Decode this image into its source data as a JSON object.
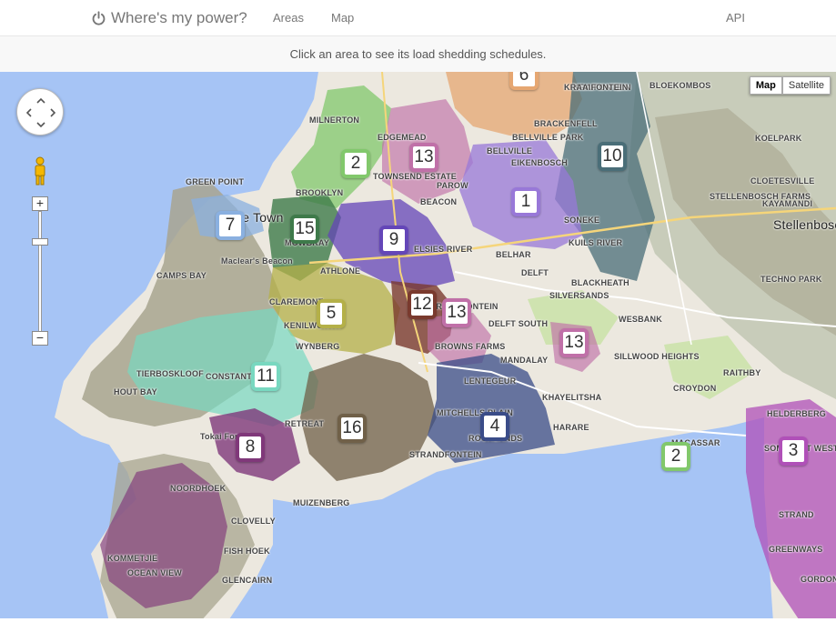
{
  "app": {
    "title": "Where's my power?",
    "nav": [
      "Areas",
      "Map",
      "API"
    ]
  },
  "instruction": "Click an area to see its load shedding schedules.",
  "map": {
    "type_controls": [
      "Map",
      "Satellite"
    ],
    "active_type": "Map",
    "zoom_in": "+",
    "zoom_out": "−",
    "colors": {
      "ocean": "#a6c4f5",
      "land": "#ece8df",
      "mountain": "#a8a58f",
      "green": "#cfe3b0"
    },
    "markers": [
      {
        "label": "6",
        "color": "#e6a772"
      },
      {
        "label": "2",
        "color": "#82c86c"
      },
      {
        "label": "13",
        "color": "#c070a8"
      },
      {
        "label": "10",
        "color": "#4a6e78"
      },
      {
        "label": "1",
        "color": "#9878d8"
      },
      {
        "label": "7",
        "color": "#8ab0e0"
      },
      {
        "label": "15",
        "color": "#3e7a4a"
      },
      {
        "label": "9",
        "color": "#6446b8"
      },
      {
        "label": "5",
        "color": "#b4b048"
      },
      {
        "label": "12",
        "color": "#7a3a2e"
      },
      {
        "label": "13",
        "color": "#c070a8"
      },
      {
        "label": "13",
        "color": "#c070a8"
      },
      {
        "label": "11",
        "color": "#78d8c0"
      },
      {
        "label": "16",
        "color": "#706048"
      },
      {
        "label": "4",
        "color": "#3a4c88"
      },
      {
        "label": "8",
        "color": "#80387a"
      },
      {
        "label": "2",
        "color": "#82c86c"
      },
      {
        "label": "3",
        "color": "#b050b8"
      }
    ],
    "place_labels": [
      "MILNERTON",
      "EDGEMEAD",
      "BELLVILLE PARK",
      "KRAIFONTEIN",
      "BLOEKOMBOS",
      "BRACKENFELL",
      "EIKENBOSCH",
      "BELLVILLE",
      "KOELPARK",
      "SONEKE",
      "KUILS RIVER",
      "STELLENBOSCH FARMS",
      "CLOETESVILLE",
      "KAYAMANDI",
      "Stellenbosch",
      "GREEN POINT",
      "Cape Town",
      "BROOKLYN",
      "TOWNSEND ESTATE",
      "PAROW",
      "BEACON",
      "ELSIES RIVER",
      "CAMPS BAY",
      "Maclear's Beacon",
      "MOWBRAY",
      "ATHLONE",
      "BELHAR",
      "DELFT",
      "BLACKHEATH",
      "SILVERSANDS",
      "MATROOSFONTEIN",
      "CLAREMONT",
      "KENILWORTH",
      "WYNBERG",
      "DELFT SOUTH",
      "WESBANK",
      "BROWNS FARMS",
      "MANDALAY",
      "SILLWOOD HEIGHTS",
      "RAITHBY",
      "HOUT BAY",
      "CONSTANTIA",
      "TIERBOSKLOOF",
      "LENTEGEUR",
      "KHAYELITSHA",
      "CROYDON",
      "MITCHELLS PLAIN",
      "MACASSAR",
      "HARARE",
      "Tokai Forest",
      "RETREAT",
      "STRANDFONTEIN",
      "HELDERBERG",
      "SOMERSET WEST",
      "NOORDHOEK",
      "MUIZENBERG",
      "CLOVELLY",
      "FISH HOEK",
      "KOMMETJIE",
      "OCEAN VIEW",
      "STRAND",
      "GREENWAYS",
      "GORDON",
      "GLENCAIRN",
      "TECHNO PARK",
      "ROCKLANDS",
      "KRAAIFONTEIN"
    ]
  }
}
